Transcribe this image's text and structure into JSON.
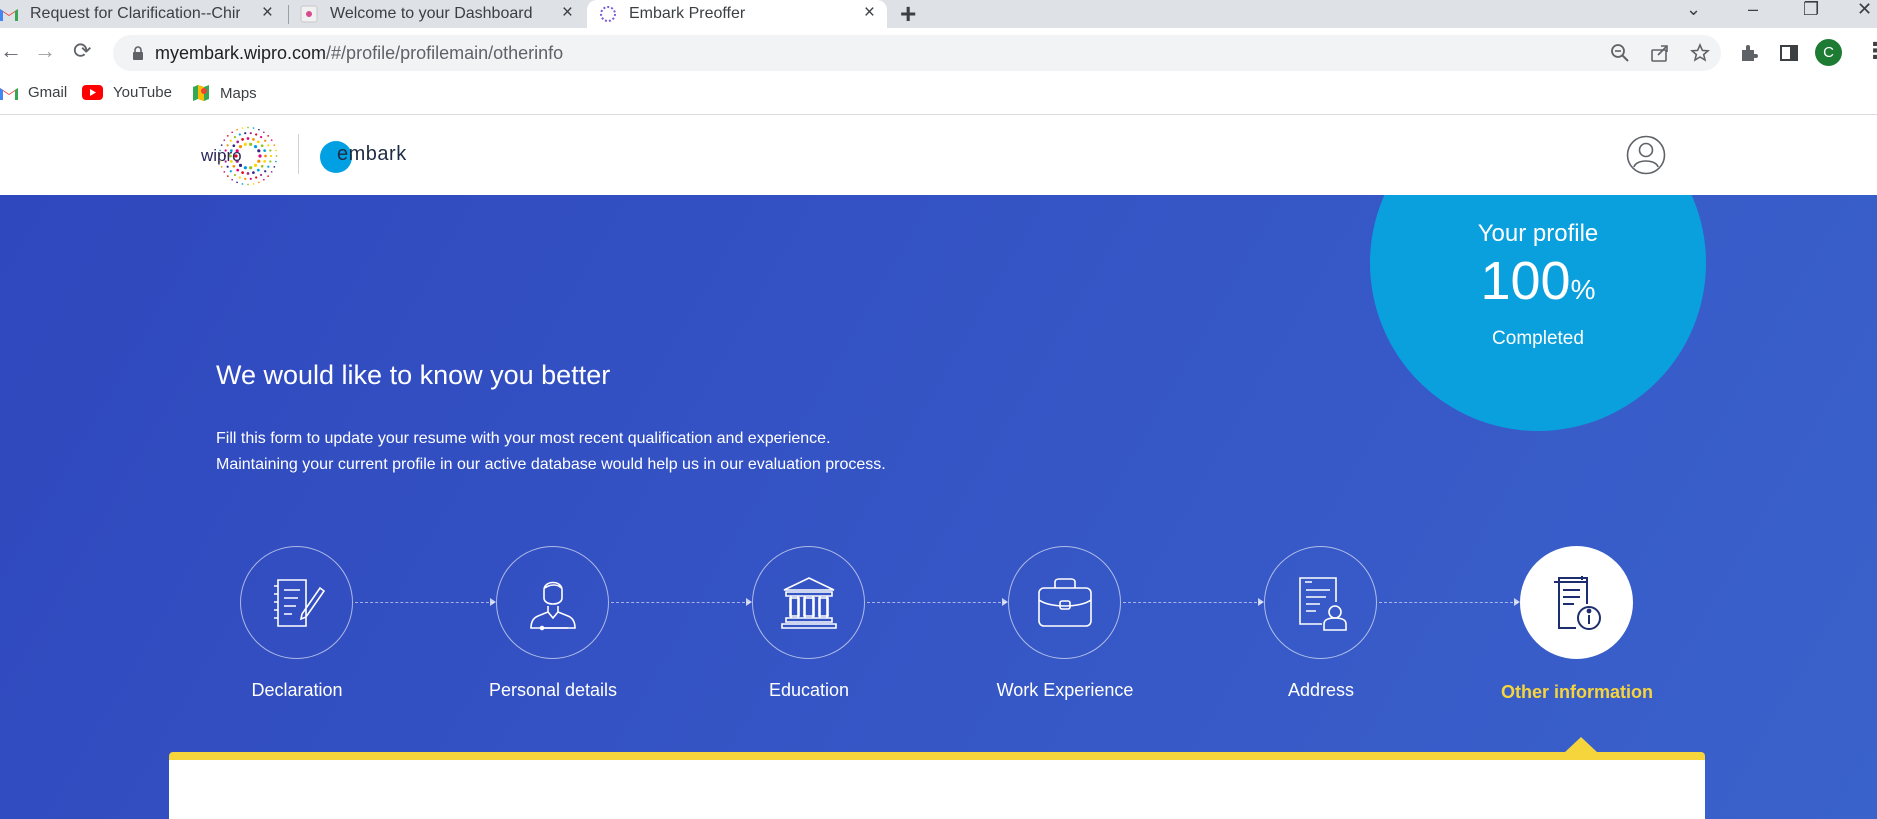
{
  "browser": {
    "tabs": [
      {
        "title": "Request for Clarification--Chirag",
        "icon": "gmail-icon"
      },
      {
        "title": "Welcome to your Dashboard",
        "icon": "wipro-favicon"
      },
      {
        "title": "Embark Preoffer",
        "icon": "wipro-favicon",
        "active": true
      }
    ],
    "url_host": "myembark.wipro.com",
    "url_path": "/#/profile/profilemain/otherinfo",
    "profile_initial": "C",
    "bookmarks": [
      {
        "label": "Gmail",
        "icon": "gmail-icon"
      },
      {
        "label": "YouTube",
        "icon": "youtube-icon"
      },
      {
        "label": "Maps",
        "icon": "maps-icon"
      }
    ]
  },
  "header": {
    "logo_text": "wipro",
    "product_name": "embark"
  },
  "profile_progress": {
    "label_top": "Your profile",
    "value": "100",
    "unit": "%",
    "label_bottom": "Completed",
    "percent": 100
  },
  "hero": {
    "title": "We would like to know you better",
    "line1": "Fill this form to update your resume with your most recent qualification and experience.",
    "line2": "Maintaining your current profile in our active database would help us in our evaluation process."
  },
  "steps": [
    {
      "label": "Declaration",
      "icon": "declaration-icon"
    },
    {
      "label": "Personal details",
      "icon": "person-icon"
    },
    {
      "label": "Education",
      "icon": "institution-icon"
    },
    {
      "label": "Work Experience",
      "icon": "briefcase-icon"
    },
    {
      "label": "Address",
      "icon": "address-card-icon"
    },
    {
      "label": "Other information",
      "icon": "info-document-icon",
      "active": true
    }
  ],
  "colors": {
    "hero_blue": "#3352c4",
    "progress_circle": "#0aa0de",
    "active_step_yellow": "#f6d53c"
  }
}
